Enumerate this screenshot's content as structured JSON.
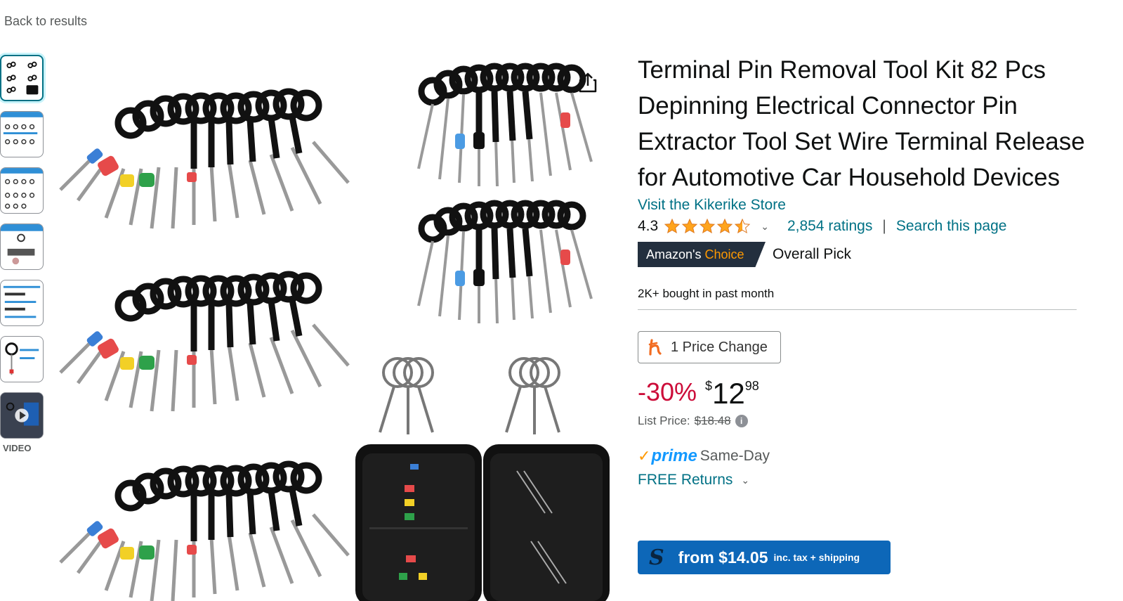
{
  "nav": {
    "back_label": "Back to results"
  },
  "gallery": {
    "thumbnails": [
      {
        "name": "thumb-kits-grid"
      },
      {
        "name": "thumb-pin-sizes"
      },
      {
        "name": "thumb-pin-sizes-2"
      },
      {
        "name": "thumb-usage"
      },
      {
        "name": "thumb-instructions"
      },
      {
        "name": "thumb-single-tool"
      },
      {
        "name": "thumb-video"
      }
    ],
    "video_label": "VIDEO",
    "share_icon": "share-icon"
  },
  "product": {
    "title": "Terminal Pin Removal Tool Kit 82 Pcs Depinning Electrical Connector Pin Extractor Tool Set Wire Terminal Release for Automotive Car Household Devices",
    "store_link": "Visit the Kikerike Store",
    "rating": "4.3",
    "rating_stars": 4.3,
    "ratings_count": "2,854 ratings",
    "separator": "|",
    "search_page": "Search this page",
    "badge_prefix": "Amazon's ",
    "badge_choice": "Choice",
    "overall_pick": "Overall Pick",
    "bought": "2K+ bought in past month",
    "price_change": "1 Price Change",
    "discount": "-30%",
    "currency": "$",
    "price_whole": "12",
    "price_fraction": "98",
    "list_price_label": "List Price:",
    "list_price": "$18.48",
    "prime_label": "prime",
    "same_day": "Same-Day",
    "free_returns": "FREE Returns",
    "shop_from": "from $14.05",
    "shop_tax": "inc. tax + shipping"
  },
  "colors": {
    "link": "#007185",
    "discount": "#cc0c39",
    "badge_bg": "#232f3e",
    "badge_accent": "#ff9900",
    "prime_blue": "#1399ff",
    "star": "#ffa41c",
    "shop_button": "#0d67b8"
  }
}
